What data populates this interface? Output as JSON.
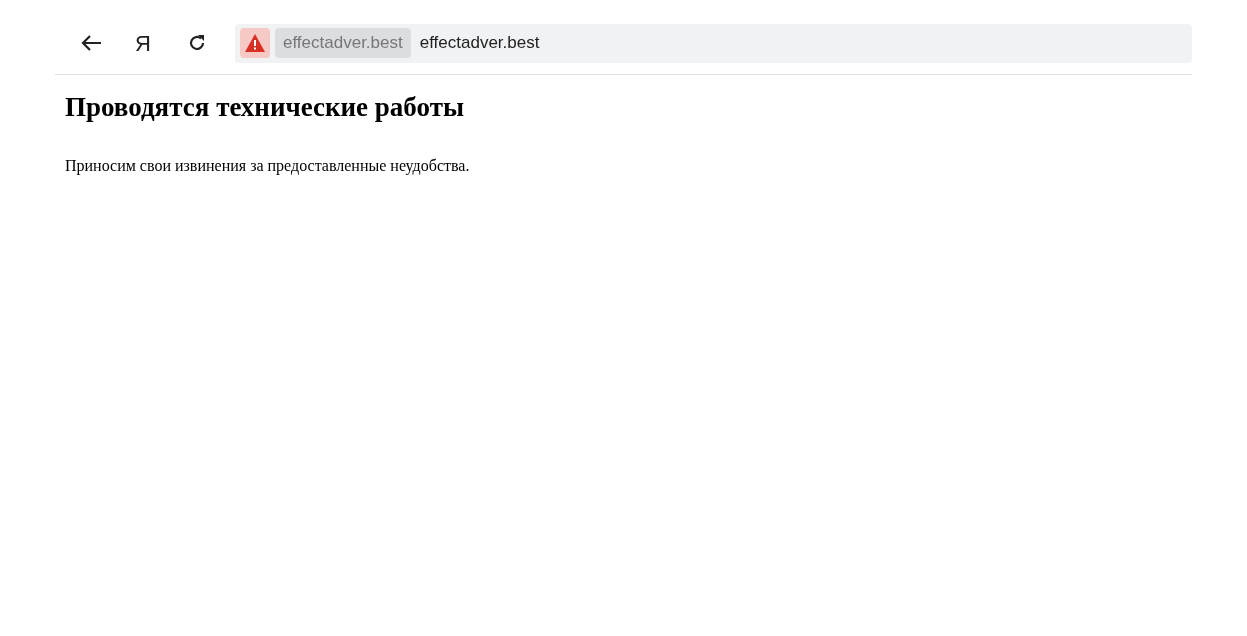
{
  "toolbar": {
    "home_button": "Я",
    "address_bar": {
      "site_chip": "effectadver.best",
      "url": "effectadver.best"
    }
  },
  "page": {
    "heading": "Проводятся технические работы",
    "paragraph": "Приносим свои извинения за предоставленные неудобства."
  }
}
